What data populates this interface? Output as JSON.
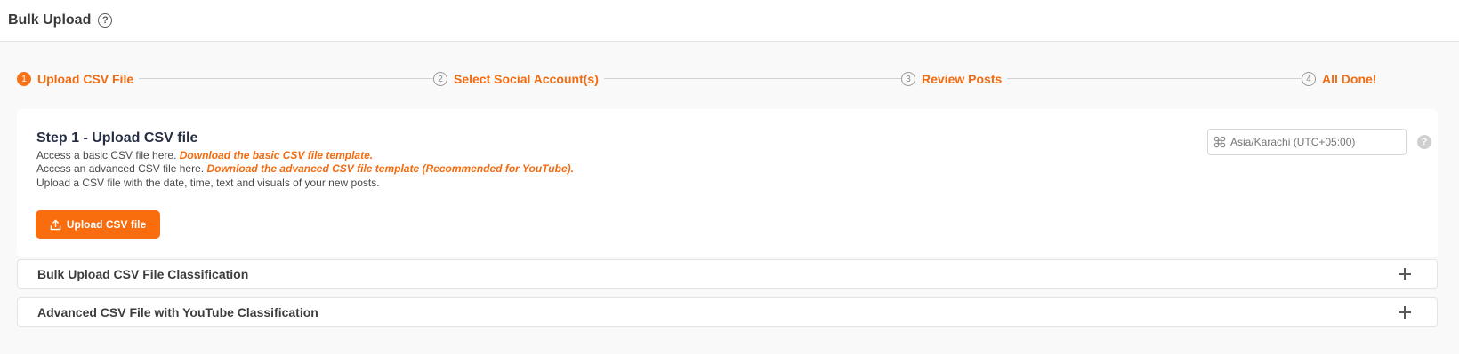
{
  "header": {
    "title": "Bulk Upload",
    "help_icon": "question-circle-icon",
    "help_glyph": "?"
  },
  "stepper": {
    "active_step": 1,
    "accent_color": "#f97316",
    "steps": [
      {
        "number": "1",
        "label": "Upload CSV File"
      },
      {
        "number": "2",
        "label": "Select Social Account(s)"
      },
      {
        "number": "3",
        "label": "Review Posts"
      },
      {
        "number": "4",
        "label": "All Done!"
      }
    ]
  },
  "step_card": {
    "title": "Step 1 - Upload CSV file",
    "line1_prefix": "Access a basic CSV file here. ",
    "line1_link": "Download the basic CSV file template.",
    "line2_prefix": "Access an advanced CSV file here. ",
    "line2_link": "Download the advanced CSV file template (Recommended for YouTube).",
    "line3": "Upload a CSV file with the date, time, text and visuals of your new posts.",
    "upload_button": "Upload CSV file",
    "upload_icon": "upload-icon",
    "timezone_placeholder": "Asia/Karachi (UTC+05:00)",
    "timezone_icon": "command-icon",
    "timezone_help_glyph": "?"
  },
  "accordions": [
    {
      "title": "Bulk Upload CSV File Classification",
      "icon": "plus-icon"
    },
    {
      "title": "Advanced CSV File with YouTube Classification",
      "icon": "plus-icon"
    }
  ]
}
